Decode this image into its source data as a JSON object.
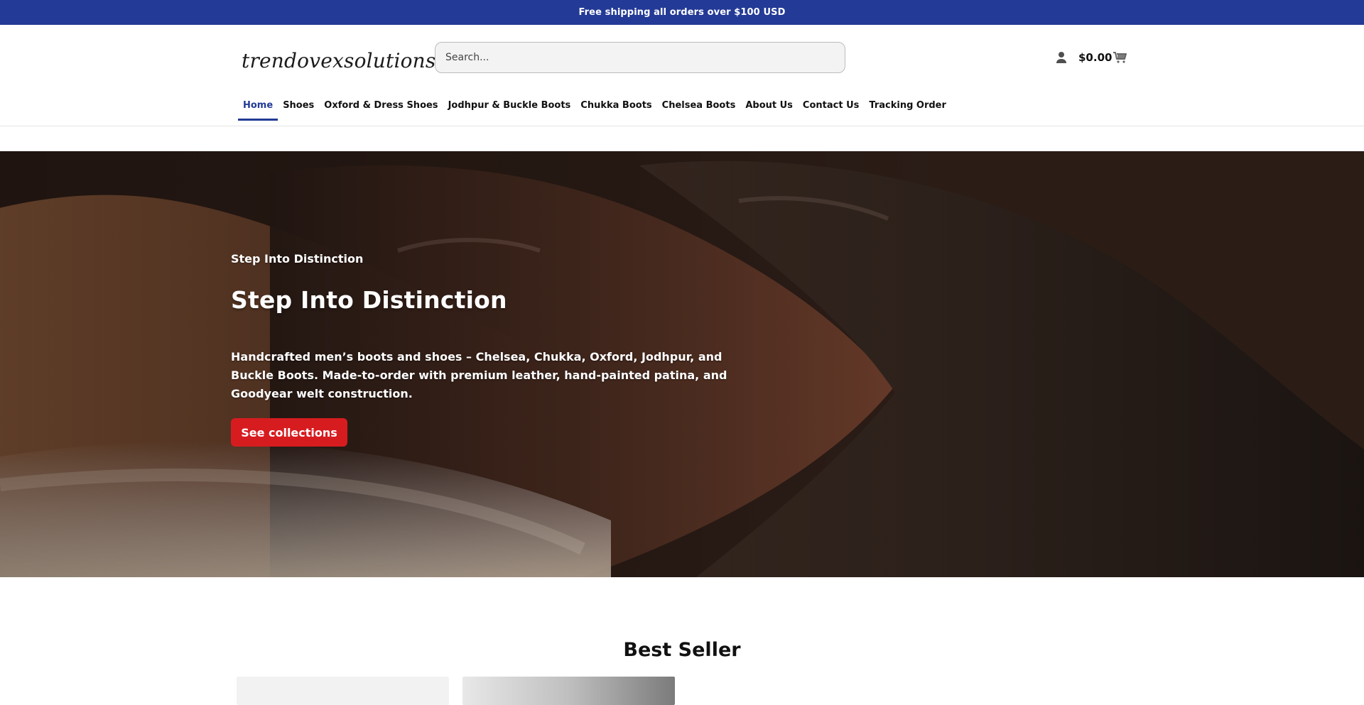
{
  "promo": {
    "text": "Free shipping all orders over $100 USD"
  },
  "header": {
    "logo_text": "trendovexsolutions",
    "search": {
      "placeholder": "Search..."
    },
    "cart": {
      "total": "$0.00"
    },
    "nav": {
      "items": [
        {
          "label": "Home",
          "active": true
        },
        {
          "label": "Shoes",
          "active": false
        },
        {
          "label": "Oxford & Dress Shoes",
          "active": false
        },
        {
          "label": "Jodhpur & Buckle Boots",
          "active": false
        },
        {
          "label": "Chukka Boots",
          "active": false
        },
        {
          "label": "Chelsea Boots",
          "active": false
        },
        {
          "label": "About Us",
          "active": false
        },
        {
          "label": "Contact Us",
          "active": false
        },
        {
          "label": "Tracking Order",
          "active": false
        }
      ]
    }
  },
  "hero": {
    "kicker": "Step Into Distinction",
    "title": "Step Into Distinction",
    "text": "Handcrafted men’s boots and shoes – Chelsea, Chukka, Oxford, Jodhpur, and Buckle Boots. Made-to-order with premium leather, hand-painted patina, and Goodyear welt construction.",
    "button_label": "See collections"
  },
  "best_seller": {
    "title": "Best Seller"
  },
  "colors": {
    "brand_blue": "#233a96",
    "accent_red": "#d71c20"
  }
}
